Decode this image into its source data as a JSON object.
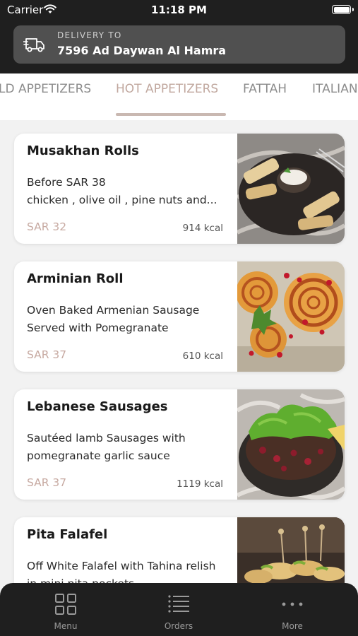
{
  "status_bar": {
    "carrier": "Carrier",
    "time": "11:18 PM"
  },
  "delivery": {
    "label": "DELIVERY TO",
    "address": "7596 Ad Daywan Al Hamra"
  },
  "tabs": [
    {
      "label": "COLD APPETIZERS",
      "visible_text": "LD APPETIZERS",
      "active": false
    },
    {
      "label": "HOT APPETIZERS",
      "visible_text": "HOT APPETIZERS",
      "active": true
    },
    {
      "label": "FATTAH",
      "visible_text": "FATTAH",
      "active": false
    },
    {
      "label": "ITALIAN",
      "visible_text": "ITALIAN",
      "active": false
    }
  ],
  "items": [
    {
      "title": "Musakhan Rolls",
      "desc1": "Before SAR 38",
      "desc2": "chicken , olive oil , pine nuts and...",
      "price": "SAR 32",
      "kcal": "914 kcal"
    },
    {
      "title": "Arminian Roll",
      "desc1": "Oven Baked Armenian Sausage",
      "desc2": "Served with Pomegranate",
      "price": "SAR 37",
      "kcal": "610 kcal"
    },
    {
      "title": "Lebanese Sausages",
      "desc1": "Sautéed lamb Sausages with",
      "desc2": "pomegranate garlic sauce",
      "price": "SAR 37",
      "kcal": "1119 kcal"
    },
    {
      "title": "Pita Falafel",
      "desc1": "Off White Falafel with Tahina relish",
      "desc2": "in mini pita pockets",
      "price": "",
      "kcal": ""
    }
  ],
  "bottom_nav": {
    "menu": "Menu",
    "orders": "Orders",
    "more": "More"
  },
  "colors": {
    "header_bg": "#1f1f1f",
    "accent": "#c1a89f",
    "price": "#c7aaa2"
  },
  "icons": [
    "wifi-icon",
    "battery-icon",
    "truck-icon",
    "menu-grid-icon",
    "orders-list-icon",
    "more-dots-icon"
  ]
}
